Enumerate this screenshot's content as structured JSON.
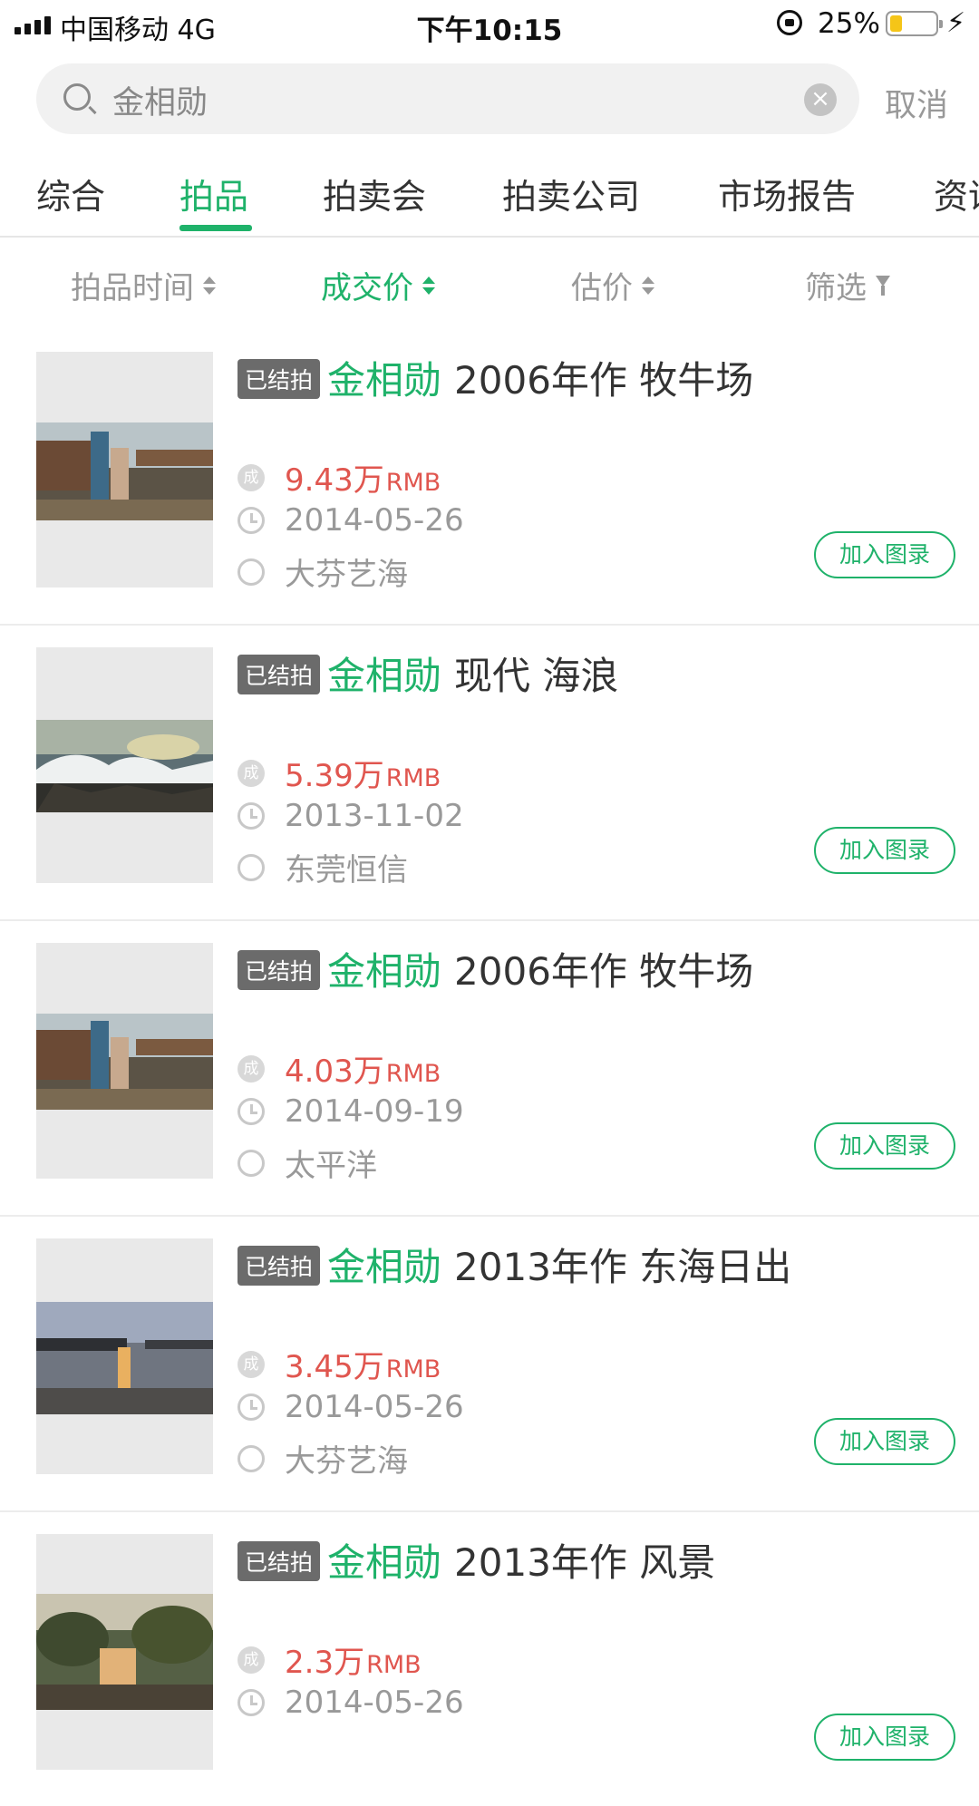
{
  "status_bar": {
    "carrier": "中国移动   4G",
    "time": "下午10:15",
    "battery_percent": "25%"
  },
  "search": {
    "value": "金相勋",
    "cancel_label": "取消"
  },
  "tabs": [
    {
      "label": "综合"
    },
    {
      "label": "拍品"
    },
    {
      "label": "拍卖会"
    },
    {
      "label": "拍卖公司"
    },
    {
      "label": "市场报告"
    },
    {
      "label": "资讯"
    }
  ],
  "active_tab": "拍品",
  "sort": {
    "time": "拍品时间",
    "price": "成交价",
    "estimate": "估价",
    "filter": "筛选"
  },
  "colors": {
    "accent": "#1fb26a",
    "price": "#e0564f",
    "badge": "#6b6b6b"
  },
  "labels": {
    "status_badge": "已结拍",
    "deal_mark": "成",
    "add_button": "加入图录",
    "currency": "RMB"
  },
  "items": [
    {
      "artist": "金相勋",
      "title": "2006年作 牧牛场",
      "price": "9.43万",
      "date": "2014-05-26",
      "house": "大芬艺海"
    },
    {
      "artist": "金相勋",
      "title": "现代 海浪",
      "price": "5.39万",
      "date": "2013-11-02",
      "house": "东莞恒信"
    },
    {
      "artist": "金相勋",
      "title": "2006年作 牧牛场",
      "price": "4.03万",
      "date": "2014-09-19",
      "house": "太平洋"
    },
    {
      "artist": "金相勋",
      "title": "2013年作 东海日出",
      "price": "3.45万",
      "date": "2014-05-26",
      "house": "大芬艺海"
    },
    {
      "artist": "金相勋",
      "title": "2013年作 风景",
      "price": "2.3万",
      "date": "2014-05-26",
      "house": ""
    }
  ]
}
